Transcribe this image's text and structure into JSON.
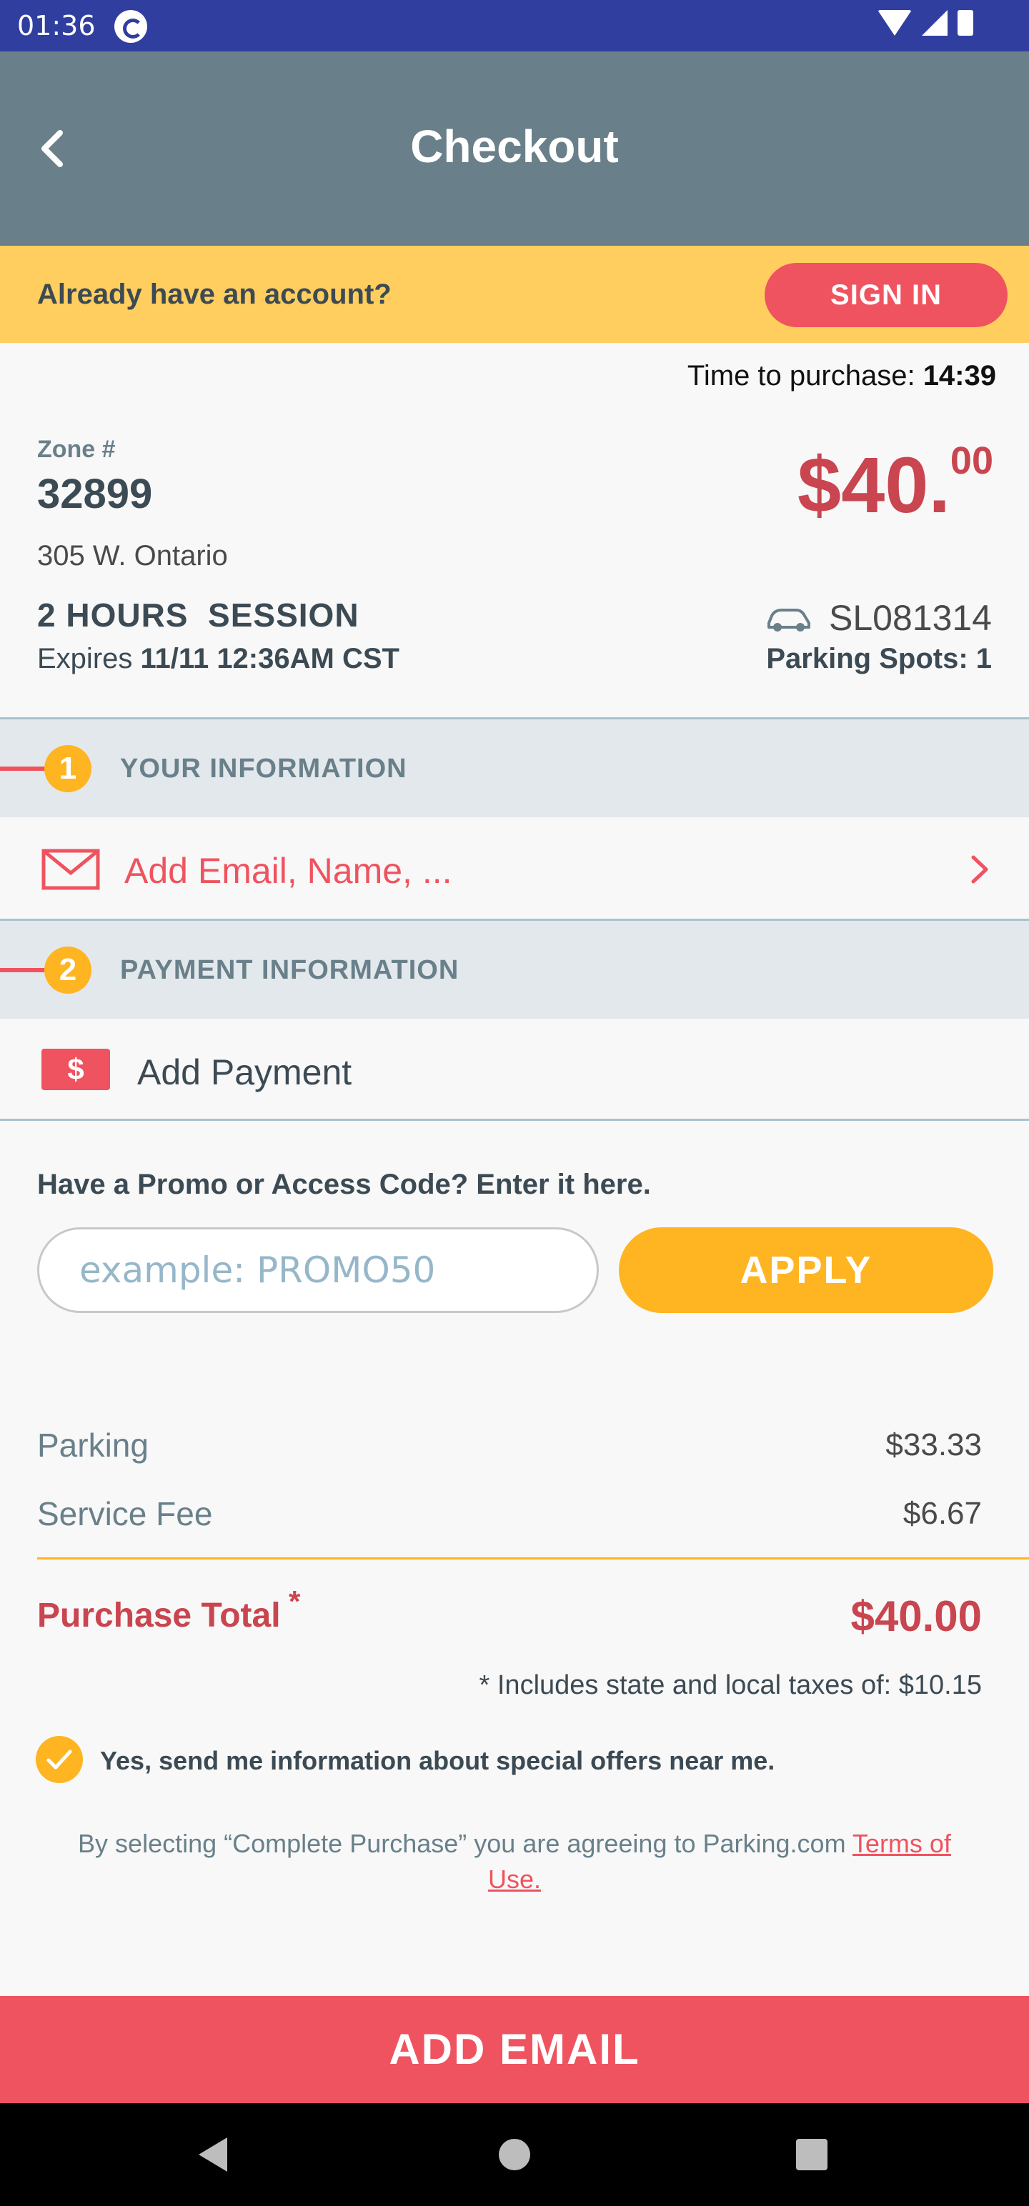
{
  "status_bar": {
    "time": "01:36"
  },
  "header": {
    "title": "Checkout"
  },
  "account_banner": {
    "text": "Already have an account?",
    "signin_label": "SIGN IN"
  },
  "timer": {
    "label": "Time to purchase:",
    "value": "14:39"
  },
  "zone": {
    "label": "Zone #",
    "number": "32899",
    "price_main": "$40.",
    "price_cents": "00",
    "address": "305 W. Ontario",
    "session": "2 HOURS  SESSION",
    "expires_label": "Expires",
    "expires_value": "11/11 12:36AM CST",
    "plate": "SL081314",
    "spots": "Parking Spots: 1"
  },
  "sections": [
    {
      "number": "1",
      "title": "YOUR INFORMATION",
      "action_label": "Add Email, Name, ..."
    },
    {
      "number": "2",
      "title": "PAYMENT INFORMATION",
      "action_label": "Add Payment",
      "icon_text": "$"
    }
  ],
  "promo": {
    "label": "Have a Promo or Access Code? Enter it here.",
    "placeholder": "example: PROMO50",
    "apply_label": "APPLY"
  },
  "summary": {
    "rows": [
      {
        "label": "Parking",
        "value": "$33.33"
      },
      {
        "label": "Service Fee",
        "value": "$6.67"
      }
    ],
    "total_label": "Purchase Total",
    "total_star": "*",
    "total_value": "$40.00",
    "taxes_note": "* Includes state and local taxes of: $10.15"
  },
  "offers": {
    "text": "Yes, send me information about special offers near me.",
    "checked": true
  },
  "legal": {
    "text": "By selecting “Complete Purchase” you are agreeing to Parking.com ",
    "link": "Terms of Use."
  },
  "cta": {
    "label": "ADD EMAIL"
  },
  "colors": {
    "accent": "#ef535f",
    "header": "#69808a",
    "banner": "#ffce5f",
    "button_yellow": "#ffb421",
    "price": "#c9454f"
  },
  "icons": [
    "back-arrow-icon",
    "car-icon",
    "mail-icon",
    "chevron-right-icon",
    "dollar-icon",
    "check-icon"
  ]
}
